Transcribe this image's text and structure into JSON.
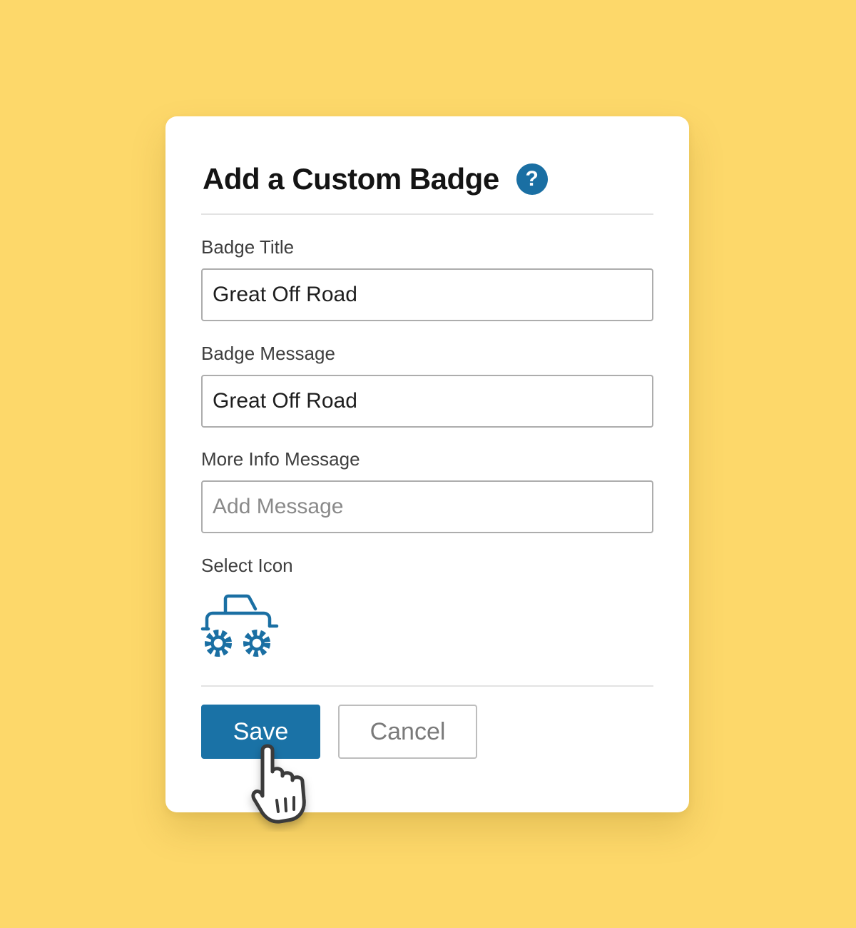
{
  "dialog": {
    "title": "Add a Custom Badge",
    "help_icon": "question-circle-icon"
  },
  "fields": {
    "badge_title": {
      "label": "Badge Title",
      "value": "Great Off Road"
    },
    "badge_message": {
      "label": "Badge Message",
      "value": "Great Off Road"
    },
    "more_info": {
      "label": "More Info Message",
      "value": "",
      "placeholder": "Add Message"
    }
  },
  "icon_select": {
    "label": "Select Icon",
    "selected_icon": "monster-truck-icon"
  },
  "actions": {
    "save_label": "Save",
    "cancel_label": "Cancel"
  },
  "colors": {
    "background": "#FDD86A",
    "accent": "#1A72A6"
  }
}
